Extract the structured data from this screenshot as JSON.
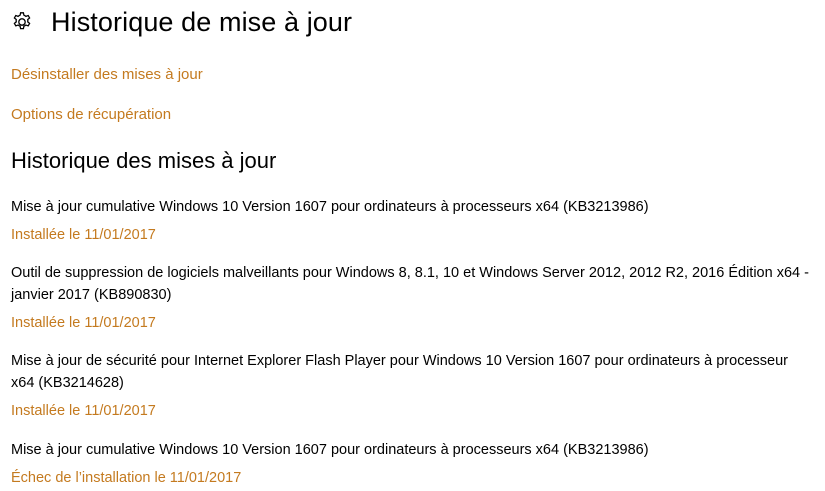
{
  "header": {
    "title": "Historique de mise à jour",
    "icon": "gear-icon"
  },
  "links": {
    "uninstall": "Désinstaller des mises à jour",
    "recovery": "Options de récupération"
  },
  "section": {
    "title": "Historique des mises à jour"
  },
  "updates": [
    {
      "title": "Mise à jour cumulative Windows 10 Version 1607 pour ordinateurs à processeurs x64 (KB3213986)",
      "status": "Installée le 11/01/2017"
    },
    {
      "title": "Outil de suppression de logiciels malveillants pour Windows 8, 8.1, 10 et Windows Server 2012, 2012 R2, 2016 Édition x64 - janvier 2017 (KB890830)",
      "status": "Installée le 11/01/2017"
    },
    {
      "title": "Mise à jour de sécurité pour Internet Explorer Flash Player pour Windows 10 Version 1607 pour ordinateurs à processeur x64 (KB3214628)",
      "status": "Installée le 11/01/2017"
    },
    {
      "title": "Mise à jour cumulative Windows 10 Version 1607 pour ordinateurs à processeurs x64 (KB3213986)",
      "status": "Échec de l’installation le 11/01/2017"
    }
  ],
  "colors": {
    "accent": "#c47a1f",
    "text": "#000000",
    "background": "#ffffff"
  }
}
